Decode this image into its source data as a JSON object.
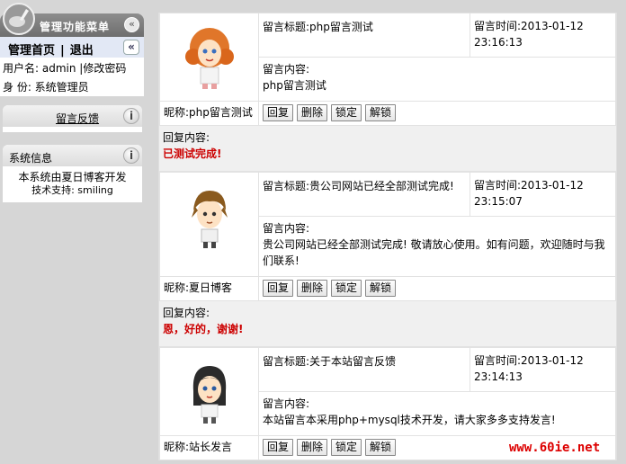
{
  "sidebar": {
    "menu_title": "管理功能菜单",
    "home_label": "管理首页",
    "separator": "|",
    "logout_label": "退出",
    "username_line": "用户名: admin |修改密码",
    "role_line": "身  份: 系统管理员",
    "feedback_label": "留言反馈",
    "sysinfo_title": "系统信息",
    "sysinfo_line1": "本系统由夏日博客开发",
    "sysinfo_line2": "技术支持: smiling"
  },
  "messages": [
    {
      "title": "留言标题:php留言测试",
      "time": "留言时间:2013-01-12 23:16:13",
      "content_label": "留言内容:",
      "content": "php留言测试",
      "nickname": "昵称:php留言测试",
      "reply_label": "回复内容:",
      "reply": "已测试完成!"
    },
    {
      "title": "留言标题:贵公司网站已经全部测试完成!",
      "time": "留言时间:2013-01-12 23:15:07",
      "content_label": "留言内容:",
      "content": "贵公司网站已经全部测试完成! 敬请放心使用。如有问题，欢迎随时与我们联系!",
      "nickname": "昵称:夏日博客",
      "reply_label": "回复内容:",
      "reply": "恩，好的，谢谢!"
    },
    {
      "title": "留言标题:关于本站留言反馈",
      "time": "留言时间:2013-01-12 23:14:13",
      "content_label": "留言内容:",
      "content": "本站留言本采用php+mysql技术开发，请大家多多支持发言!",
      "nickname": "昵称:站长发言",
      "reply_label": "",
      "reply": ""
    }
  ],
  "buttons": {
    "reply": "回复",
    "delete": "删除",
    "lock": "锁定",
    "unlock": "解锁"
  },
  "watermark": "www.60ie.net",
  "colors": {
    "background": "#d6d6d6",
    "reply_text": "#cc0000",
    "menu_header": "#777777"
  }
}
